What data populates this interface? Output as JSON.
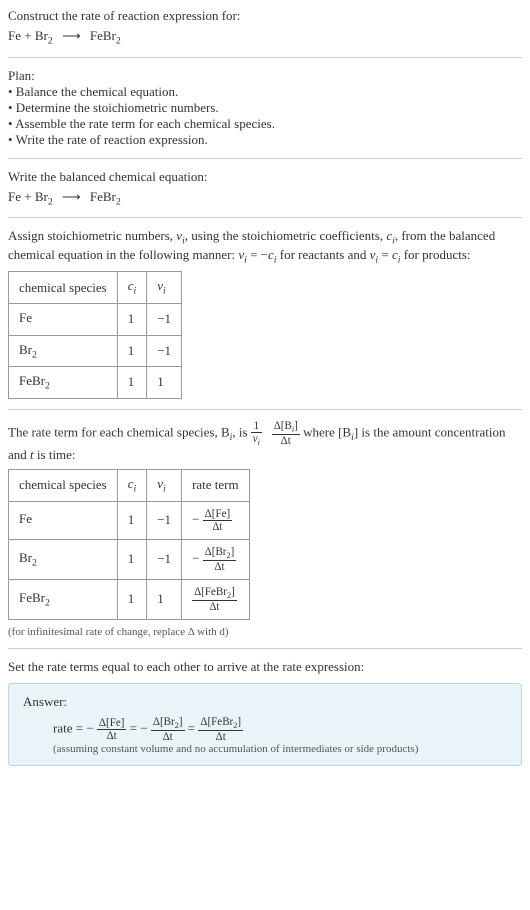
{
  "title_line1": "Construct the rate of reaction expression for:",
  "equation_unbalanced_lhs1": "Fe + Br",
  "equation_unbalanced_lhs1_sub": "2",
  "equation_arrow": "⟶",
  "equation_unbalanced_rhs1": "FeBr",
  "equation_unbalanced_rhs1_sub": "2",
  "plan_heading": "Plan:",
  "plan_items": [
    "• Balance the chemical equation.",
    "• Determine the stoichiometric numbers.",
    "• Assemble the rate term for each chemical species.",
    "• Write the rate of reaction expression."
  ],
  "balanced_heading": "Write the balanced chemical equation:",
  "balanced_lhs1": "Fe + Br",
  "balanced_lhs1_sub": "2",
  "balanced_rhs1": "FeBr",
  "balanced_rhs1_sub": "2",
  "stoich_text1": "Assign stoichiometric numbers, ",
  "stoich_nu": "ν",
  "stoich_sub_i": "i",
  "stoich_text2": ", using the stoichiometric coefficients, ",
  "stoich_c": "c",
  "stoich_text3": ", from the balanced chemical equation in the following manner: ",
  "stoich_eq1_lhs": "ν",
  "stoich_eq1_eq": " = −",
  "stoich_eq1_rhs": "c",
  "stoich_text4": " for reactants and ",
  "stoich_eq2_eq": " = ",
  "stoich_text5": " for products:",
  "table1": {
    "headers": [
      "chemical species",
      "cᵢ",
      "νᵢ"
    ],
    "h0": "chemical species",
    "h1_c": "c",
    "h1_sub": "i",
    "h2_nu": "ν",
    "h2_sub": "i",
    "rows": [
      {
        "species_main": "Fe",
        "species_sub": "",
        "c": "1",
        "nu": "−1"
      },
      {
        "species_main": "Br",
        "species_sub": "2",
        "c": "1",
        "nu": "−1"
      },
      {
        "species_main": "FeBr",
        "species_sub": "2",
        "c": "1",
        "nu": "1"
      }
    ]
  },
  "rateterm_text1": "The rate term for each chemical species, B",
  "rateterm_text2": ", is ",
  "rateterm_frac1_num": "1",
  "rateterm_frac1_den_nu": "ν",
  "rateterm_frac1_den_sub": "i",
  "rateterm_frac2_num": "Δ[B",
  "rateterm_frac2_num_sub": "i",
  "rateterm_frac2_num_close": "]",
  "rateterm_frac2_den": "Δt",
  "rateterm_text3": " where [B",
  "rateterm_text4": "] is the amount concentration and ",
  "rateterm_t": "t",
  "rateterm_text5": " is time:",
  "table2": {
    "h0": "chemical species",
    "h1_c": "c",
    "h1_sub": "i",
    "h2_nu": "ν",
    "h2_sub": "i",
    "h3": "rate term",
    "rows": [
      {
        "species_main": "Fe",
        "species_sub": "",
        "c": "1",
        "nu": "−1",
        "sign": "−",
        "num": "Δ[Fe]",
        "den": "Δt"
      },
      {
        "species_main": "Br",
        "species_sub": "2",
        "c": "1",
        "nu": "−1",
        "sign": "−",
        "num_a": "Δ[Br",
        "num_sub": "2",
        "num_b": "]",
        "den": "Δt"
      },
      {
        "species_main": "FeBr",
        "species_sub": "2",
        "c": "1",
        "nu": "1",
        "sign": "",
        "num_a": "Δ[FeBr",
        "num_sub": "2",
        "num_b": "]",
        "den": "Δt"
      }
    ]
  },
  "note_infinitesimal": "(for infinitesimal rate of change, replace Δ with d)",
  "final_heading": "Set the rate terms equal to each other to arrive at the rate expression:",
  "answer_label": "Answer:",
  "answer_rate": "rate = −",
  "answer_eq": " = ",
  "answer_eq_neg": " = −",
  "answer_frac1_num": "Δ[Fe]",
  "answer_frac1_den": "Δt",
  "answer_frac2_num_a": "Δ[Br",
  "answer_frac2_num_sub": "2",
  "answer_frac2_num_b": "]",
  "answer_frac2_den": "Δt",
  "answer_frac3_num_a": "Δ[FeBr",
  "answer_frac3_num_sub": "2",
  "answer_frac3_num_b": "]",
  "answer_frac3_den": "Δt",
  "answer_note": "(assuming constant volume and no accumulation of intermediates or side products)"
}
